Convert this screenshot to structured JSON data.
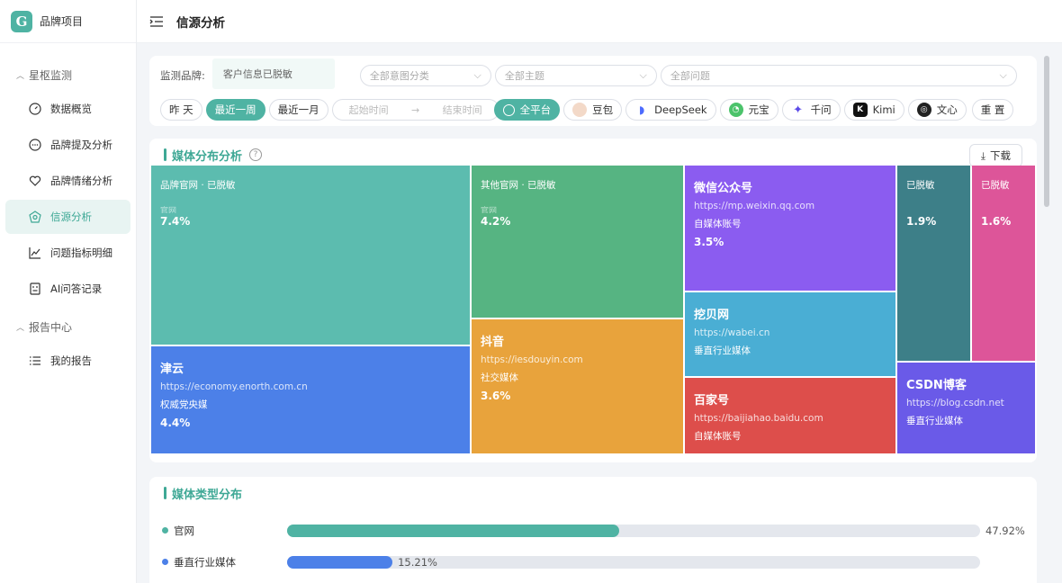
{
  "app": {
    "name": "品牌项目"
  },
  "sidebar": {
    "groups": [
      {
        "label": "星枢监测",
        "items": [
          {
            "label": "数据概览",
            "icon": "dashboard-icon"
          },
          {
            "label": "品牌提及分析",
            "icon": "chat-icon"
          },
          {
            "label": "品牌情绪分析",
            "icon": "heart-icon"
          },
          {
            "label": "信源分析",
            "icon": "source-icon",
            "active": true
          },
          {
            "label": "问题指标明细",
            "icon": "chart-line-icon"
          },
          {
            "label": "AI问答记录",
            "icon": "robot-icon"
          }
        ]
      },
      {
        "label": "报告中心",
        "items": [
          {
            "label": "我的报告",
            "icon": "list-icon"
          }
        ]
      }
    ]
  },
  "topbar": {
    "title": "信源分析"
  },
  "filters": {
    "brand_label": "监测品牌:",
    "brand_value": "客户信息已脱敏",
    "intent_placeholder": "全部意图分类",
    "topic_placeholder": "全部主题",
    "question_placeholder": "全部问题",
    "periods": [
      "昨 天",
      "最近一周",
      "最近一月"
    ],
    "active_period": "最近一周",
    "start_placeholder": "起始时间",
    "end_placeholder": "结束时间",
    "platforms": [
      {
        "label": "全平台",
        "icon": "globe-icon",
        "active": true
      },
      {
        "label": "豆包",
        "icon": "doubao-icon"
      },
      {
        "label": "DeepSeek",
        "icon": "deepseek-icon"
      },
      {
        "label": "元宝",
        "icon": "yuanbao-icon"
      },
      {
        "label": "千问",
        "icon": "qianwen-icon"
      },
      {
        "label": "Kimi",
        "icon": "kimi-icon"
      },
      {
        "label": "文心",
        "icon": "wenxin-icon"
      }
    ],
    "reset_label": "重 置"
  },
  "media_dist": {
    "title": "媒体分布分析",
    "download_label": "下载",
    "tiles": [
      {
        "name": "品牌官网 · 已脱敏",
        "ghost": "官网",
        "pct": "7.4%",
        "color": "#5cbcaf"
      },
      {
        "name": "其他官网 · 已脱敏",
        "ghost": "官网",
        "pct": "4.2%",
        "color": "#56b482"
      },
      {
        "name": "微信公众号",
        "url": "https://mp.weixin.qq.com",
        "cat": "自媒体账号",
        "pct": "3.5%",
        "color": "#8b5cf0"
      },
      {
        "name": "已脱敏",
        "pct": "1.9%",
        "color": "#3d7f88"
      },
      {
        "name": "已脱敏",
        "pct": "1.6%",
        "color": "#dd5599"
      },
      {
        "name": "挖贝网",
        "url": "https://wabei.cn",
        "cat": "垂直行业媒体",
        "color": "#4aaed4"
      },
      {
        "name": "抖音",
        "url": "https://iesdouyin.com",
        "cat": "社交媒体",
        "pct": "3.6%",
        "color": "#e8a33c"
      },
      {
        "name": "津云",
        "url": "https://economy.enorth.com.cn",
        "cat": "权威党央媒",
        "pct": "4.4%",
        "color": "#4c80e8"
      },
      {
        "name": "百家号",
        "url": "https://baijiahao.baidu.com",
        "cat": "自媒体账号",
        "color": "#dd4e4b"
      },
      {
        "name": "CSDN博客",
        "url": "https://blog.csdn.net",
        "cat": "垂直行业媒体",
        "color": "#6a5ae8"
      }
    ]
  },
  "media_type": {
    "title": "媒体类型分布",
    "rows": [
      {
        "label": "官网",
        "value": 47.92,
        "pct": "47.92%",
        "color": "#4fb3a3"
      },
      {
        "label": "垂直行业媒体",
        "value": 15.21,
        "pct": "15.21%",
        "color": "#4c80e8"
      }
    ]
  }
}
